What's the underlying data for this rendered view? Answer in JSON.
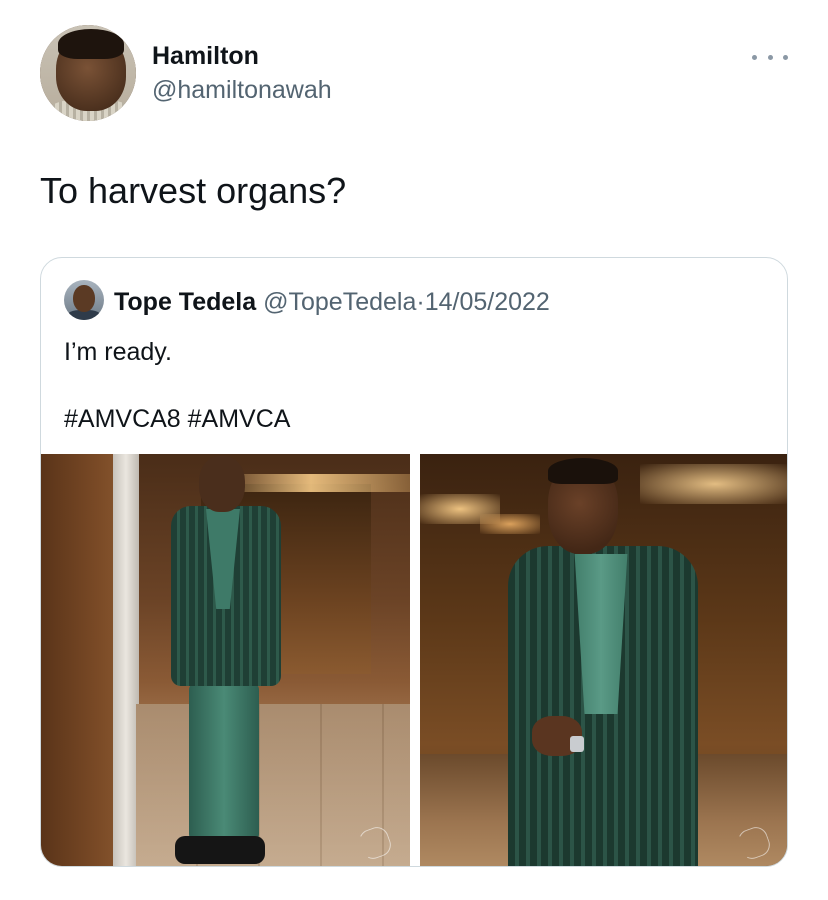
{
  "tweet": {
    "author": {
      "display_name": "Hamilton",
      "handle": "@hamiltonawah"
    },
    "text": "To harvest organs?",
    "more_icon": "more-horizontal-icon"
  },
  "quoted_tweet": {
    "author": {
      "display_name": "Tope Tedela",
      "handle": "@TopeTedela"
    },
    "separator": "·",
    "date": "14/05/2022",
    "text": "I’m ready.",
    "hashtags": "#AMVCA8 #AMVCA",
    "photos": [
      {
        "name": "photo-full-body"
      },
      {
        "name": "photo-close-up"
      }
    ]
  },
  "colors": {
    "text_primary": "#0f1419",
    "text_secondary": "#536471",
    "border": "#cfd9de",
    "suit_green": "#2c5447"
  }
}
